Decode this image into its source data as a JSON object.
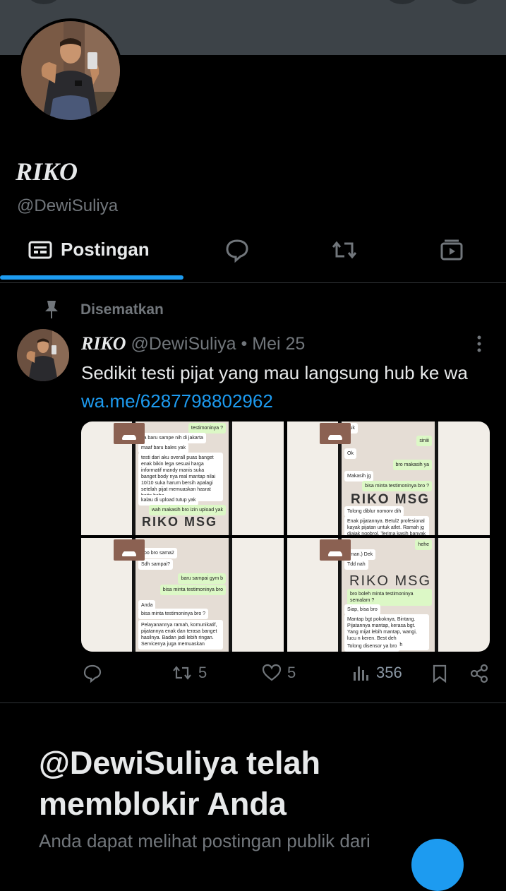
{
  "profile": {
    "display_name": "RIKO",
    "handle": "@DewiSuliya"
  },
  "tabs": [
    {
      "label": "Postingan",
      "icon": "posts-icon",
      "active": true
    },
    {
      "label": "",
      "icon": "reply-icon"
    },
    {
      "label": "",
      "icon": "repost-icon"
    },
    {
      "label": "",
      "icon": "media-icon"
    }
  ],
  "pinned": {
    "label": "Disematkan",
    "icon": "pin-icon"
  },
  "post": {
    "author_name": "RIKO",
    "author_handle": "@DewiSuliya",
    "separator": "•",
    "date": "Mei 25",
    "text": "Sedikit testi pijat yang mau langsung hub ke wa",
    "link": "wa.me/6287798802962",
    "media": [
      {
        "watermark": "RIKO MSG",
        "bubbles": [
          "testimoninya ?",
          "ya baru sampe nih di jakarta",
          "maaf baru bales yak",
          "testi dari aku overall puas banget enak bikin lega sesuai harga informatif mandy manis suka banget body nya real mantap nilai 10/10 suka harum bersih apalagi setelah pijat memuaskan hasrat batin haha",
          "kalau di upload tutup yak",
          "wah makasih bro izin upload yak"
        ]
      },
      {
        "watermark": "RIKO MSG",
        "bubbles": [
          "yuk",
          "siniii",
          "Ok",
          "bro makasih ya",
          "Makasih jg",
          "bisa minta testimoninya bro ?",
          "Tolong diblur nomorv dih",
          "Enak pijatannya. Betul2 profesional kayak pijatan untuk atlet. Ramah jg diajak ngobrol. Terima kasih banyak"
        ]
      },
      {
        "watermark": "RIKO MSG",
        "bubbles": [
          "Yoo bro sama2",
          "Sdh sampai?",
          "baru sampai gym b",
          "bisa minta testimoninya bro",
          "Anda",
          "bisa minta testimoninya bro ?",
          "Pelayanannya ramah, komunikatif, pijatannya enak dan terasa banget hasilnya. Badan jadi lebih ringan. Servicenya juga memuaskan"
        ]
      },
      {
        "watermark": "RIKO MSG",
        "bubbles": [
          "hehe",
          "aman.) Dek",
          "Tdd nah",
          "bro boleh minta testimoninya semalam ?",
          "Siap, bisa bro",
          "Mantap bgt pokoknya, Bintang. Pijatannya mantap, kerasa bgt. Yang mijat lebih mantap, wangi, lucu n keren. Best deh treatmentnya, bikin nagih",
          "Tolong disensor ya bro"
        ]
      }
    ],
    "actions": {
      "reply_count": "",
      "repost_count": "5",
      "like_count": "5",
      "views_count": "356"
    }
  },
  "blocked": {
    "title": "@DewiSuliya telah memblokir Anda",
    "subtitle": "Anda dapat melihat postingan publik dari"
  },
  "colors": {
    "background": "#000000",
    "accent": "#1d9bf0",
    "muted": "#71767b",
    "text": "#e7e9ea",
    "banner": "#3d4348"
  }
}
